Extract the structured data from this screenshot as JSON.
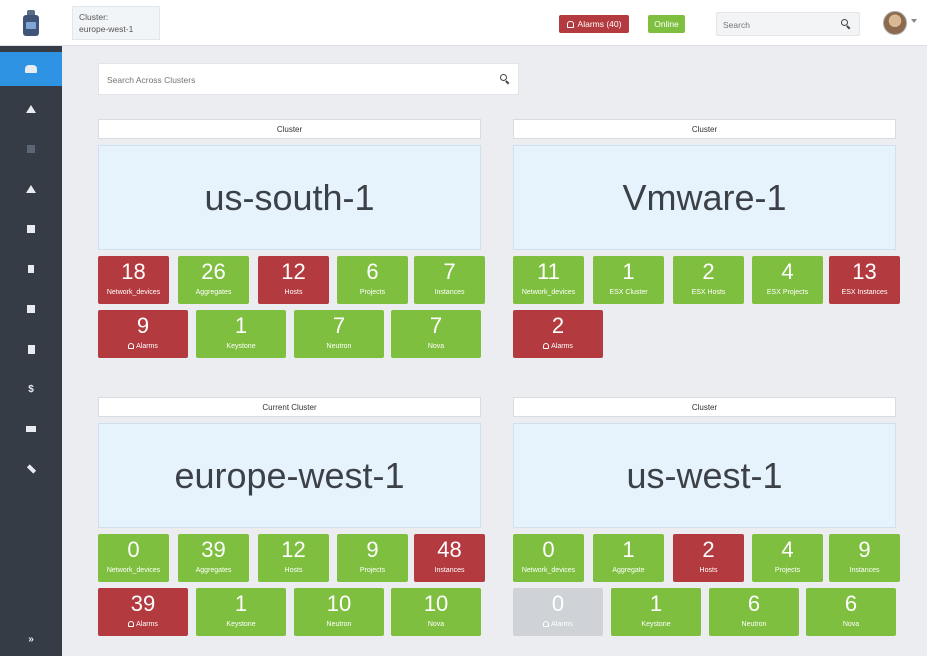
{
  "header": {
    "cluster_label": "Cluster:",
    "cluster_value": "europe-west-1",
    "alarms_label": "Alarms (40)",
    "online_label": "Online",
    "search_placeholder": "Search",
    "colors": {
      "alarm": "#b33b3f",
      "ok": "#7fbf3f",
      "accent": "#2f93e4"
    }
  },
  "sidebar": {
    "items": [
      {
        "icon": "users-icon",
        "active": true
      },
      {
        "icon": "home-icon"
      },
      {
        "icon": "mail-icon"
      },
      {
        "icon": "bell-icon"
      },
      {
        "icon": "server-icon"
      },
      {
        "icon": "chart-icon"
      },
      {
        "icon": "database-icon"
      },
      {
        "icon": "file-icon"
      },
      {
        "icon": "dollar-icon"
      },
      {
        "icon": "sitemap-icon"
      },
      {
        "icon": "wrench-icon"
      },
      {
        "icon": "expand-icon"
      }
    ]
  },
  "main": {
    "search_placeholder": "Search Across Clusters",
    "clusters": [
      {
        "label": "Cluster",
        "name": "us-south-1",
        "row1": [
          {
            "value": "18",
            "label": "Network_devices",
            "status": "red"
          },
          {
            "value": "26",
            "label": "Aggregates",
            "status": "green"
          },
          {
            "value": "12",
            "label": "Hosts",
            "status": "red"
          },
          {
            "value": "6",
            "label": "Projects",
            "status": "green"
          },
          {
            "value": "7",
            "label": "Instances",
            "status": "green"
          }
        ],
        "row2": [
          {
            "value": "9",
            "label": "Alarms",
            "status": "red",
            "bell": true
          },
          {
            "value": "1",
            "label": "Keystone",
            "status": "green"
          },
          {
            "value": "7",
            "label": "Neutron",
            "status": "green"
          },
          {
            "value": "7",
            "label": "Nova",
            "status": "green"
          }
        ]
      },
      {
        "label": "Cluster",
        "name": "Vmware-1",
        "row1": [
          {
            "value": "11",
            "label": "Network_devices",
            "status": "green"
          },
          {
            "value": "1",
            "label": "ESX Cluster",
            "status": "green"
          },
          {
            "value": "2",
            "label": "ESX Hosts",
            "status": "green"
          },
          {
            "value": "4",
            "label": "ESX Projects",
            "status": "green"
          },
          {
            "value": "13",
            "label": "ESX Instances",
            "status": "red"
          }
        ],
        "row2": [
          {
            "value": "2",
            "label": "Alarms",
            "status": "red",
            "bell": true
          }
        ]
      },
      {
        "label": "Current Cluster",
        "name": "europe-west-1",
        "row1": [
          {
            "value": "0",
            "label": "Network_devices",
            "status": "green"
          },
          {
            "value": "39",
            "label": "Aggregates",
            "status": "green"
          },
          {
            "value": "12",
            "label": "Hosts",
            "status": "green"
          },
          {
            "value": "9",
            "label": "Projects",
            "status": "green"
          },
          {
            "value": "48",
            "label": "Instances",
            "status": "red"
          }
        ],
        "row2": [
          {
            "value": "39",
            "label": "Alarms",
            "status": "red",
            "bell": true
          },
          {
            "value": "1",
            "label": "Keystone",
            "status": "green"
          },
          {
            "value": "10",
            "label": "Neutron",
            "status": "green"
          },
          {
            "value": "10",
            "label": "Nova",
            "status": "green"
          }
        ]
      },
      {
        "label": "Cluster",
        "name": "us-west-1",
        "row1": [
          {
            "value": "0",
            "label": "Network_devices",
            "status": "green"
          },
          {
            "value": "1",
            "label": "Aggregate",
            "status": "green"
          },
          {
            "value": "2",
            "label": "Hosts",
            "status": "red"
          },
          {
            "value": "4",
            "label": "Projects",
            "status": "green"
          },
          {
            "value": "9",
            "label": "Instances",
            "status": "green"
          }
        ],
        "row2": [
          {
            "value": "0",
            "label": "Alarms",
            "status": "grey",
            "bell": true
          },
          {
            "value": "1",
            "label": "Keystone",
            "status": "green"
          },
          {
            "value": "6",
            "label": "Neutron",
            "status": "green"
          },
          {
            "value": "6",
            "label": "Nova",
            "status": "green"
          }
        ]
      }
    ]
  }
}
